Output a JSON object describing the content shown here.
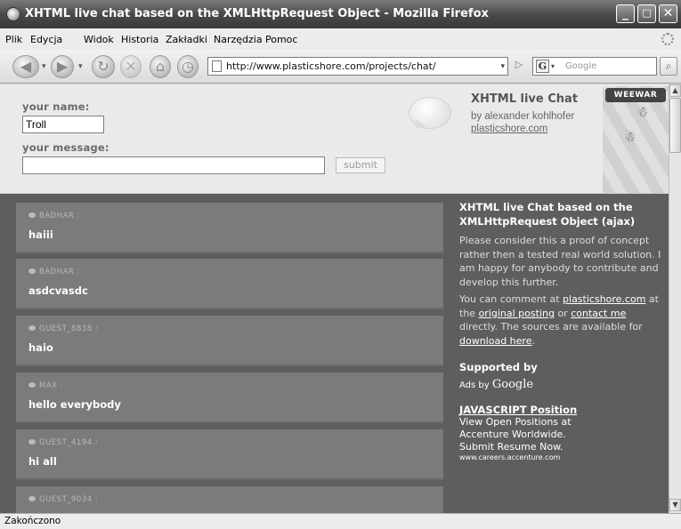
{
  "window": {
    "title": "XHTML live chat based on the XMLHttpRequest Object - Mozilla Firefox"
  },
  "menu": [
    "Plik",
    "Edycja",
    "Widok",
    "Historia",
    "Zakładki",
    "Narzędzia",
    "Pomoc"
  ],
  "address": {
    "url": "http://www.plasticshore.com/projects/chat/"
  },
  "search": {
    "placeholder": "Google"
  },
  "form": {
    "name_label": "your name:",
    "name_value": "Troll",
    "message_label": "your message:",
    "message_value": "",
    "submit_label": "submit"
  },
  "app": {
    "title": "XHTML live Chat",
    "by": "by alexander kohlhofer",
    "site": "plasticshore.com",
    "banner": "WEEWAR"
  },
  "messages": [
    {
      "user": "BADHAR :",
      "text": "haiii"
    },
    {
      "user": "BADHAR :",
      "text": "asdcvasdc"
    },
    {
      "user": "GUEST_8838 :",
      "text": "haio"
    },
    {
      "user": "MAX :",
      "text": "hello everybody"
    },
    {
      "user": "GUEST_4194 :",
      "text": "hi all"
    },
    {
      "user": "GUEST_9034 :",
      "text": ""
    }
  ],
  "side": {
    "heading": "XHTML live Chat based on the XMLHttpRequest Object (ajax)",
    "para1": "Please consider this a proof of concept rather then a tested real world solution. I am happy for anybody to contribute and develop this further.",
    "para2_a": "You can comment at ",
    "link_site": "plasticshore.com",
    "para2_b": " at the ",
    "link_original": "original posting",
    "para2_c": " or ",
    "link_contact": "contact me",
    "para2_d": " directly. The sources are available for ",
    "link_download": "download here",
    "para2_e": ".",
    "supported": "Supported by",
    "ads_by": "Ads by",
    "ads_brand": "Google",
    "ad_title": "JAVASCRIPT Position",
    "ad_line1": "View Open Positions at",
    "ad_line2": "Accenture Worldwide.",
    "ad_line3": "Submit Resume Now.",
    "ad_url": "www.careers.accenture.com"
  },
  "status": {
    "text": "Zakończono"
  }
}
